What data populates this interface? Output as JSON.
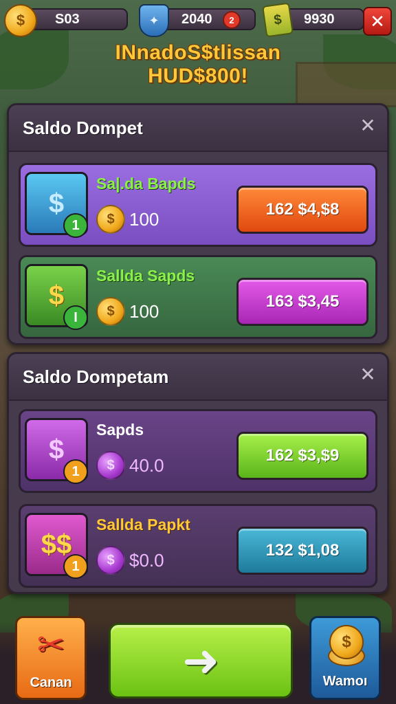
{
  "hud": {
    "coins": "S03",
    "coin_symbol": "$",
    "shield_value": "2040",
    "notification_count": "2",
    "cash_value": "9930",
    "close_symbol": "✕"
  },
  "banner": {
    "line1": "INnadoS$tlissan",
    "line2": "HUD$800!"
  },
  "panels": [
    {
      "title": "Saldo Dompet",
      "rows": [
        {
          "name": "Sa|.da Bapds",
          "amount": "100",
          "price": "162 $4,$8",
          "badge": "1",
          "icon": "gem-box-icon",
          "coin": "gold-coin-icon"
        },
        {
          "name": "Sallda Sapds",
          "amount": "100",
          "price": "163 $3,45",
          "badge": "I",
          "icon": "gold-coin-icon",
          "coin": "gold-coin-icon"
        }
      ]
    },
    {
      "title": "Saldo Dompetam",
      "rows": [
        {
          "name": "Sapds",
          "amount": "40.0",
          "price": "162 $3,$9",
          "badge": "1",
          "icon": "purple-coin-icon",
          "coin": "purple-coin-icon"
        },
        {
          "name": "Sallda Papkt",
          "amount": "$0.0",
          "price": "132 $1,08",
          "badge": "1",
          "icon": "coin-stack-icon",
          "coin": "purple-coin-icon"
        }
      ]
    }
  ],
  "bottom": {
    "cancel_label": "Canan",
    "go_symbol": "➜",
    "wallet_label": "Wamoı"
  },
  "colors": {
    "panel_bg": "#463a4e",
    "row1_bg": "#8a5ccf",
    "row2_bg": "#3f7a4a",
    "row3_bg": "#5a3a7a",
    "row4_bg": "#503a62",
    "btn_orange": "#f06a1a",
    "btn_magenta": "#c83ad0",
    "btn_green": "#7ad21a",
    "btn_teal": "#2a98b8"
  }
}
